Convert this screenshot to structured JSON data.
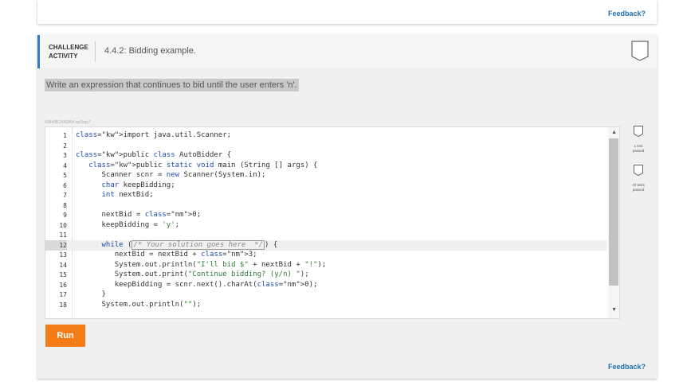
{
  "top_card": {
    "feedback_label": "Feedback?"
  },
  "activity": {
    "type_label_line1": "CHALLENGE",
    "type_label_line2": "ACTIVITY",
    "title": "4.4.2: Bidding example.",
    "instruction": "Write an expression that continues to bid until the user enters 'n'.",
    "activity_id": "418408.2441854.qx3zqy7"
  },
  "editor": {
    "lines": [
      {
        "num": "1",
        "code": "import java.util.Scanner;"
      },
      {
        "num": "2",
        "code": ""
      },
      {
        "num": "3",
        "code": "public class AutoBidder {"
      },
      {
        "num": "4",
        "code": "   public static void main (String [] args) {"
      },
      {
        "num": "5",
        "code": "      Scanner scnr = new Scanner(System.in);"
      },
      {
        "num": "6",
        "code": "      char keepBidding;"
      },
      {
        "num": "7",
        "code": "      int nextBid;"
      },
      {
        "num": "8",
        "code": ""
      },
      {
        "num": "9",
        "code": "      nextBid = 0;"
      },
      {
        "num": "10",
        "code": "      keepBidding = 'y';"
      },
      {
        "num": "11",
        "code": ""
      },
      {
        "num": "12",
        "code": "      while (/* Your solution goes here  */) {"
      },
      {
        "num": "13",
        "code": "         nextBid = nextBid + 3;"
      },
      {
        "num": "14",
        "code": "         System.out.println(\"I'll bid $\" + nextBid + \"!\");"
      },
      {
        "num": "15",
        "code": "         System.out.print(\"Continue bidding? (y/n) \");"
      },
      {
        "num": "16",
        "code": "         keepBidding = scnr.next().charAt(0);"
      },
      {
        "num": "17",
        "code": "      }"
      },
      {
        "num": "18",
        "code": "      System.out.println(\"\");"
      }
    ],
    "active_line": "12"
  },
  "run_label": "Run",
  "tests": [
    {
      "text_line1": "1 test",
      "text_line2": "passed"
    },
    {
      "text_line1": "All tests",
      "text_line2": "passed"
    }
  ],
  "bottom_feedback_label": "Feedback?",
  "colors": {
    "accent": "#2e7bcf",
    "run": "#f47b16",
    "link": "#1e6fb0"
  }
}
